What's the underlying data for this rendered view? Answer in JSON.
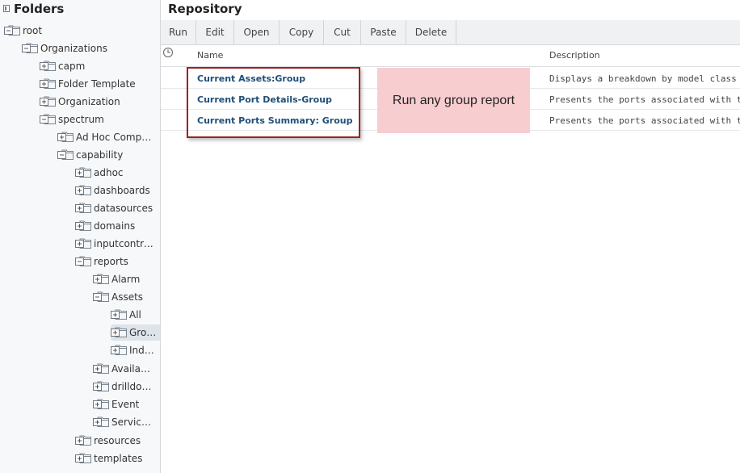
{
  "folders": {
    "title": "Folders",
    "tree": [
      {
        "label": "root",
        "expanded": true
      },
      {
        "label": "Organizations",
        "expanded": true
      },
      {
        "label": "capm",
        "expanded": false
      },
      {
        "label": "Folder Template",
        "expanded": false
      },
      {
        "label": "Organization",
        "expanded": false
      },
      {
        "label": "spectrum",
        "expanded": true
      },
      {
        "label": "Ad Hoc Compon…",
        "expanded": false
      },
      {
        "label": "capability",
        "expanded": true
      },
      {
        "label": "adhoc",
        "expanded": false
      },
      {
        "label": "dashboards",
        "expanded": false
      },
      {
        "label": "datasources",
        "expanded": false
      },
      {
        "label": "domains",
        "expanded": false
      },
      {
        "label": "inputcontrols",
        "expanded": false
      },
      {
        "label": "reports",
        "expanded": true
      },
      {
        "label": "Alarm",
        "expanded": false
      },
      {
        "label": "Assets",
        "expanded": true
      },
      {
        "label": "All",
        "expanded": false
      },
      {
        "label": "Gro…",
        "expanded": false,
        "selected": true
      },
      {
        "label": "Indi…",
        "expanded": false
      },
      {
        "label": "Availabi…",
        "expanded": false
      },
      {
        "label": "drilldow…",
        "expanded": false
      },
      {
        "label": "Event",
        "expanded": false
      },
      {
        "label": "Service…",
        "expanded": false
      },
      {
        "label": "resources",
        "expanded": false
      },
      {
        "label": "templates",
        "expanded": false
      }
    ]
  },
  "repository": {
    "title": "Repository",
    "toolbar": [
      "Run",
      "Edit",
      "Open",
      "Copy",
      "Cut",
      "Paste",
      "Delete"
    ],
    "columns": {
      "name": "Name",
      "description": "Description"
    },
    "rows": [
      {
        "name": "Current Assets:Group",
        "description": "Displays a breakdown by model class of d"
      },
      {
        "name": "Current Port Details-Group",
        "description": "Presents the ports associated with the cur"
      },
      {
        "name": "Current Ports Summary: Group",
        "description": "Presents the ports associated with the cur"
      }
    ]
  },
  "callout": {
    "text": "Run any group report"
  },
  "colors": {
    "highlight_border": "#a31f1f",
    "callout_bg": "#f8cdd0",
    "link": "#1f4e79"
  }
}
